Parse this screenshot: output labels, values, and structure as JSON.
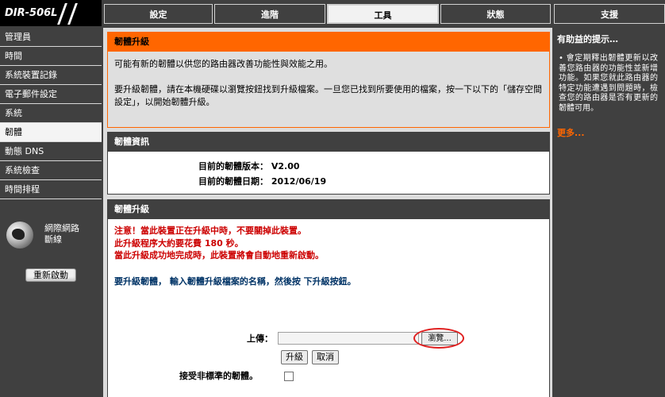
{
  "logo": {
    "text": "DIR-506L"
  },
  "tabs": [
    {
      "label": "設定"
    },
    {
      "label": "進階"
    },
    {
      "label": "工具"
    },
    {
      "label": "狀態"
    },
    {
      "label": "支援"
    }
  ],
  "sidebar": {
    "items": [
      {
        "label": "管理員"
      },
      {
        "label": "時間"
      },
      {
        "label": "系統裝置記錄"
      },
      {
        "label": "電子郵件設定"
      },
      {
        "label": "系統"
      },
      {
        "label": "韌體"
      },
      {
        "label": "動態 DNS"
      },
      {
        "label": "系統檢查"
      },
      {
        "label": "時間排程"
      }
    ],
    "network_status": "網際網路\n斷線",
    "reboot_label": "重新啟動"
  },
  "upgrade_intro": {
    "title": "韌體升級",
    "p1": "可能有新的韌體以供您的路由器改善功能性與效能之用。",
    "p2": "要升級韌體，請在本機硬碟以瀏覽按鈕找到升級檔案。一旦您已找到所要使用的檔案，按一下以下的「儲存空間設定」，以開始韌體升級。"
  },
  "firmware_info": {
    "title": "韌體資訊",
    "version_label": "目前的韌體版本：",
    "version_value": "V2.00",
    "date_label": "目前的韌體日期：",
    "date_value": "2012/06/19"
  },
  "upgrade": {
    "title": "韌體升級",
    "warning1": "注意！當此裝置正在升級中時，不要關掉此裝置。",
    "warning2": "此升級程序大約要花費 180 秒。",
    "warning3": "當此升級成功地完成時，此裝置將會自動地重新啟動。",
    "instruction": "要升級韌體， 輸入韌體升級檔案的名稱，然後按 下升級按鈕。",
    "upload_label": "上傳：",
    "browse_label": "瀏覽...",
    "upgrade_label": "升級",
    "cancel_label": "取消",
    "accept_label": "接受非標準的韌體。"
  },
  "tips": {
    "title": "有助益的提示…",
    "body": "• 會定期釋出韌體更新以改善您路由器的功能性並新增功能。如果您就此路由器的特定功能遭遇到問題時，檢查您的路由器是否有更新的韌體可用。",
    "more": "更多..."
  }
}
